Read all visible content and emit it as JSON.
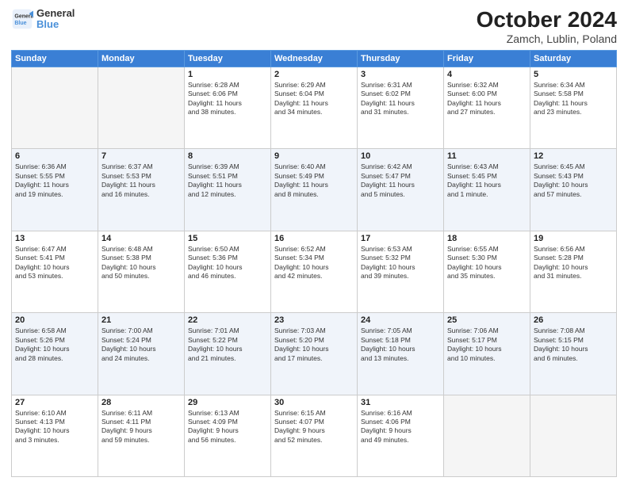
{
  "header": {
    "logo": {
      "line1": "General",
      "line2": "Blue"
    },
    "title": "October 2024",
    "subtitle": "Zamch, Lublin, Poland"
  },
  "weekdays": [
    "Sunday",
    "Monday",
    "Tuesday",
    "Wednesday",
    "Thursday",
    "Friday",
    "Saturday"
  ],
  "rows": [
    [
      {
        "day": "",
        "detail": "",
        "empty": true
      },
      {
        "day": "",
        "detail": "",
        "empty": true
      },
      {
        "day": "1",
        "detail": "Sunrise: 6:28 AM\nSunset: 6:06 PM\nDaylight: 11 hours\nand 38 minutes."
      },
      {
        "day": "2",
        "detail": "Sunrise: 6:29 AM\nSunset: 6:04 PM\nDaylight: 11 hours\nand 34 minutes."
      },
      {
        "day": "3",
        "detail": "Sunrise: 6:31 AM\nSunset: 6:02 PM\nDaylight: 11 hours\nand 31 minutes."
      },
      {
        "day": "4",
        "detail": "Sunrise: 6:32 AM\nSunset: 6:00 PM\nDaylight: 11 hours\nand 27 minutes."
      },
      {
        "day": "5",
        "detail": "Sunrise: 6:34 AM\nSunset: 5:58 PM\nDaylight: 11 hours\nand 23 minutes."
      }
    ],
    [
      {
        "day": "6",
        "detail": "Sunrise: 6:36 AM\nSunset: 5:55 PM\nDaylight: 11 hours\nand 19 minutes."
      },
      {
        "day": "7",
        "detail": "Sunrise: 6:37 AM\nSunset: 5:53 PM\nDaylight: 11 hours\nand 16 minutes."
      },
      {
        "day": "8",
        "detail": "Sunrise: 6:39 AM\nSunset: 5:51 PM\nDaylight: 11 hours\nand 12 minutes."
      },
      {
        "day": "9",
        "detail": "Sunrise: 6:40 AM\nSunset: 5:49 PM\nDaylight: 11 hours\nand 8 minutes."
      },
      {
        "day": "10",
        "detail": "Sunrise: 6:42 AM\nSunset: 5:47 PM\nDaylight: 11 hours\nand 5 minutes."
      },
      {
        "day": "11",
        "detail": "Sunrise: 6:43 AM\nSunset: 5:45 PM\nDaylight: 11 hours\nand 1 minute."
      },
      {
        "day": "12",
        "detail": "Sunrise: 6:45 AM\nSunset: 5:43 PM\nDaylight: 10 hours\nand 57 minutes."
      }
    ],
    [
      {
        "day": "13",
        "detail": "Sunrise: 6:47 AM\nSunset: 5:41 PM\nDaylight: 10 hours\nand 53 minutes."
      },
      {
        "day": "14",
        "detail": "Sunrise: 6:48 AM\nSunset: 5:38 PM\nDaylight: 10 hours\nand 50 minutes."
      },
      {
        "day": "15",
        "detail": "Sunrise: 6:50 AM\nSunset: 5:36 PM\nDaylight: 10 hours\nand 46 minutes."
      },
      {
        "day": "16",
        "detail": "Sunrise: 6:52 AM\nSunset: 5:34 PM\nDaylight: 10 hours\nand 42 minutes."
      },
      {
        "day": "17",
        "detail": "Sunrise: 6:53 AM\nSunset: 5:32 PM\nDaylight: 10 hours\nand 39 minutes."
      },
      {
        "day": "18",
        "detail": "Sunrise: 6:55 AM\nSunset: 5:30 PM\nDaylight: 10 hours\nand 35 minutes."
      },
      {
        "day": "19",
        "detail": "Sunrise: 6:56 AM\nSunset: 5:28 PM\nDaylight: 10 hours\nand 31 minutes."
      }
    ],
    [
      {
        "day": "20",
        "detail": "Sunrise: 6:58 AM\nSunset: 5:26 PM\nDaylight: 10 hours\nand 28 minutes."
      },
      {
        "day": "21",
        "detail": "Sunrise: 7:00 AM\nSunset: 5:24 PM\nDaylight: 10 hours\nand 24 minutes."
      },
      {
        "day": "22",
        "detail": "Sunrise: 7:01 AM\nSunset: 5:22 PM\nDaylight: 10 hours\nand 21 minutes."
      },
      {
        "day": "23",
        "detail": "Sunrise: 7:03 AM\nSunset: 5:20 PM\nDaylight: 10 hours\nand 17 minutes."
      },
      {
        "day": "24",
        "detail": "Sunrise: 7:05 AM\nSunset: 5:18 PM\nDaylight: 10 hours\nand 13 minutes."
      },
      {
        "day": "25",
        "detail": "Sunrise: 7:06 AM\nSunset: 5:17 PM\nDaylight: 10 hours\nand 10 minutes."
      },
      {
        "day": "26",
        "detail": "Sunrise: 7:08 AM\nSunset: 5:15 PM\nDaylight: 10 hours\nand 6 minutes."
      }
    ],
    [
      {
        "day": "27",
        "detail": "Sunrise: 6:10 AM\nSunset: 4:13 PM\nDaylight: 10 hours\nand 3 minutes."
      },
      {
        "day": "28",
        "detail": "Sunrise: 6:11 AM\nSunset: 4:11 PM\nDaylight: 9 hours\nand 59 minutes."
      },
      {
        "day": "29",
        "detail": "Sunrise: 6:13 AM\nSunset: 4:09 PM\nDaylight: 9 hours\nand 56 minutes."
      },
      {
        "day": "30",
        "detail": "Sunrise: 6:15 AM\nSunset: 4:07 PM\nDaylight: 9 hours\nand 52 minutes."
      },
      {
        "day": "31",
        "detail": "Sunrise: 6:16 AM\nSunset: 4:06 PM\nDaylight: 9 hours\nand 49 minutes."
      },
      {
        "day": "",
        "detail": "",
        "empty": true
      },
      {
        "day": "",
        "detail": "",
        "empty": true
      }
    ]
  ]
}
